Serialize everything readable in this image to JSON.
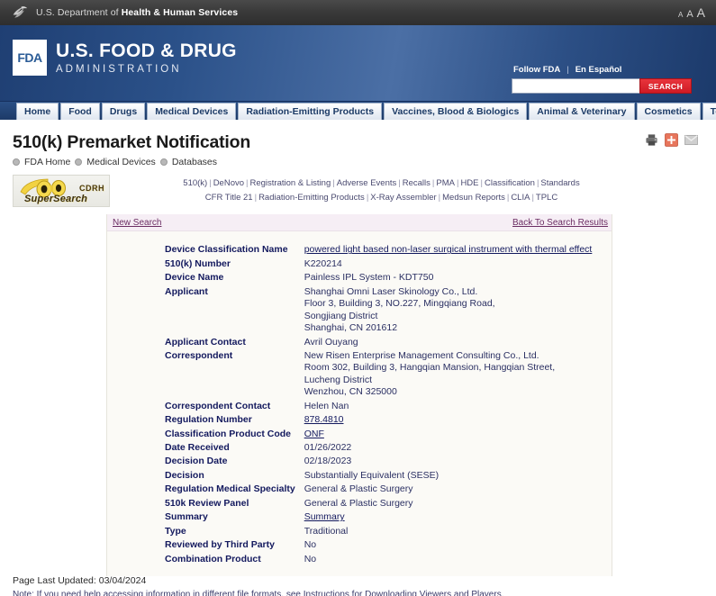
{
  "hhs_bar": {
    "agency_text_plain": "U.S. Department of ",
    "agency_text_bold": "Health & Human Services",
    "logo_icon": "hhs-eagle-logo",
    "font_size_small": "A",
    "font_size_medium": "A",
    "font_size_large": "A"
  },
  "banner": {
    "mark_text": "FDA",
    "title": "U.S. FOOD & DRUG",
    "subtitle": "ADMINISTRATION",
    "follow_label": "Follow FDA",
    "separator": "|",
    "espanol_label": "En Español",
    "search_value": "",
    "search_placeholder": "",
    "search_button_label": "SEARCH"
  },
  "nav": {
    "tabs": [
      {
        "label": "Home"
      },
      {
        "label": "Food"
      },
      {
        "label": "Drugs"
      },
      {
        "label": "Medical Devices"
      },
      {
        "label": "Radiation-Emitting Products"
      },
      {
        "label": "Vaccines, Blood & Biologics"
      },
      {
        "label": "Animal & Veterinary"
      },
      {
        "label": "Cosmetics"
      },
      {
        "label": "Tobacco Products"
      }
    ]
  },
  "page": {
    "title": "510(k) Premarket Notification",
    "breadcrumb": [
      {
        "label": "FDA Home"
      },
      {
        "label": "Medical Devices"
      },
      {
        "label": "Databases"
      }
    ],
    "icons": [
      {
        "name": "print-icon"
      },
      {
        "name": "share-icon"
      },
      {
        "name": "email-icon"
      }
    ]
  },
  "supersearch": {
    "logo_line1": "CDRH",
    "logo_line2": "SuperSearch",
    "logo_icon": "binoculars-icon",
    "links_row1": [
      "510(k)",
      "DeNovo",
      "Registration & Listing",
      "Adverse Events",
      "Recalls",
      "PMA",
      "HDE",
      "Classification",
      "Standards"
    ],
    "links_row2": [
      "CFR Title 21",
      "Radiation-Emitting Products",
      "X-Ray Assembler",
      "Medsun Reports",
      "CLIA",
      "TPLC"
    ],
    "separator": "|"
  },
  "panel": {
    "new_search_label": "New Search",
    "back_to_results_label": "Back To Search Results"
  },
  "record": {
    "rows": [
      {
        "label": "Device Classification Name",
        "value": "powered light based non-laser surgical instrument with thermal effect",
        "link": true
      },
      {
        "label": "510(k) Number",
        "value": "K220214",
        "link": false
      },
      {
        "label": "Device Name",
        "value": "Painless IPL System - KDT750",
        "link": false
      },
      {
        "label": "Applicant",
        "lines": [
          "Shanghai Omni Laser Skinology Co., Ltd.",
          "Floor 3, Building 3, NO.227, Mingqiang Road,",
          "Songjiang District",
          "Shanghai,  CN 201612"
        ],
        "link": false
      },
      {
        "label": "Applicant Contact",
        "value": "Avril Ouyang",
        "link": false
      },
      {
        "label": "Correspondent",
        "lines": [
          "New Risen Enterprise Management Consulting Co., Ltd.",
          "Room 302, Building 3, Hangqian Mansion, Hangqian Street,",
          "Lucheng District",
          "Wenzhou,  CN 325000"
        ],
        "link": false
      },
      {
        "label": "Correspondent Contact",
        "value": "Helen Nan",
        "link": false
      },
      {
        "label": "Regulation Number",
        "value": "878.4810",
        "link": true
      },
      {
        "label": "Classification Product Code",
        "value": "ONF",
        "link": true
      },
      {
        "label": "Date Received",
        "value": "01/26/2022",
        "link": false
      },
      {
        "label": "Decision Date",
        "value": "02/18/2023",
        "link": false
      },
      {
        "label": "Decision",
        "value": "Substantially Equivalent (SESE)",
        "link": false
      },
      {
        "label": "Regulation Medical Specialty",
        "value": "General & Plastic Surgery",
        "link": false
      },
      {
        "label": "510k Review Panel",
        "value": "General & Plastic Surgery",
        "link": false
      },
      {
        "label": "Summary",
        "value": "Summary",
        "link": true
      },
      {
        "label": "Type",
        "value": "Traditional",
        "link": false
      },
      {
        "label": "Reviewed by Third Party",
        "value": "No",
        "link": false
      },
      {
        "label": "Combination Product",
        "value": "No",
        "link": false
      }
    ]
  },
  "footer": {
    "last_updated": "Page Last Updated: 03/04/2024",
    "note": "Note: If you need help accessing information in different file formats, see Instructions for Downloading Viewers and Players."
  }
}
